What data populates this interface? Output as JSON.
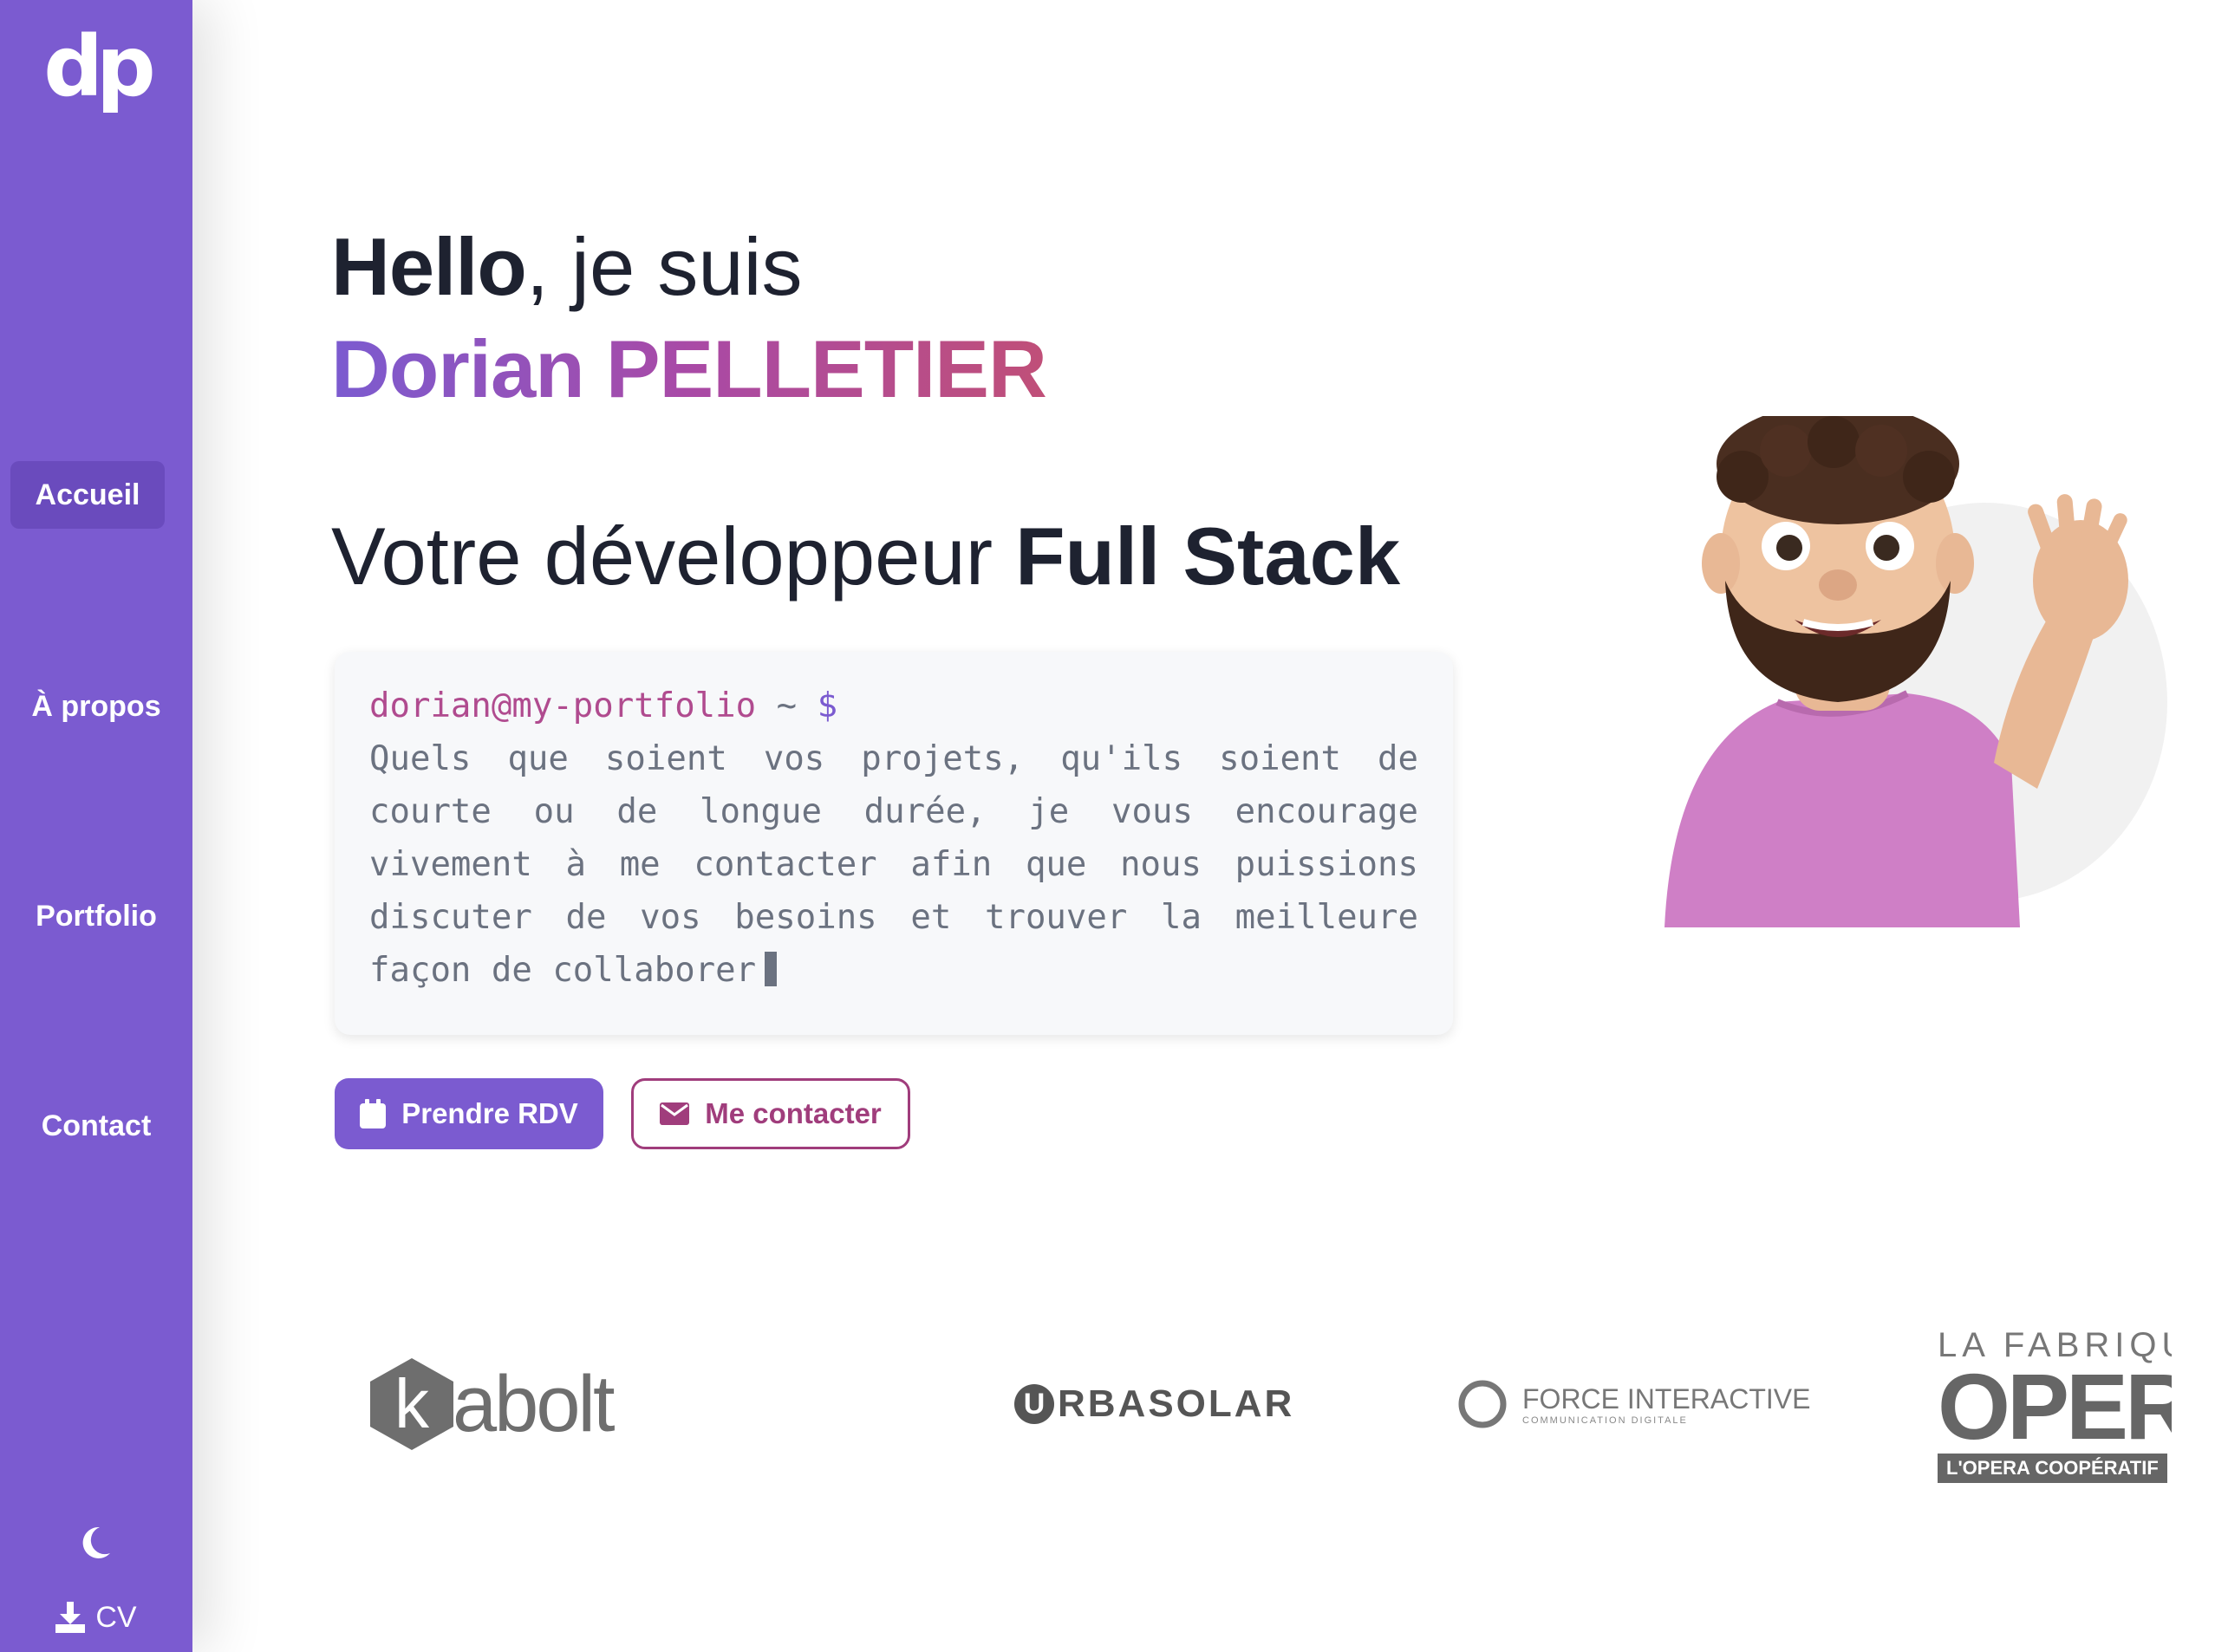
{
  "sidebar": {
    "logo": "dp",
    "nav": [
      {
        "label": "Accueil",
        "active": true
      },
      {
        "label": "À propos",
        "active": false
      },
      {
        "label": "Portfolio",
        "active": false
      },
      {
        "label": "Contact",
        "active": false
      }
    ],
    "theme_icon": "moon-icon",
    "cv_label": "CV",
    "cv_icon": "download-icon"
  },
  "hero": {
    "hello_bold": "Hello",
    "hello_rest": ", je suis",
    "name": "Dorian PELLETIER",
    "subtitle_prefix": "Votre développeur ",
    "subtitle_bold": "Full Stack"
  },
  "terminal": {
    "user": "dorian@my-portfolio",
    "tilde": "~",
    "dollar": "$",
    "text": "Quels que soient vos projets, qu'ils soient de courte ou de longue durée, je vous encourage vivement à me contacter afin que nous puissions discuter de vos besoins et trouver la meilleure façon de collaborer"
  },
  "buttons": {
    "rdv_label": "Prendre RDV",
    "rdv_icon": "calendar-icon",
    "contact_label": "Me contacter",
    "contact_icon": "envelope-icon"
  },
  "clients": [
    {
      "name": "kabolt",
      "text": "abolt",
      "mark": "k"
    },
    {
      "name": "urbasolar",
      "text": "RBASOLAR",
      "mark": "U"
    },
    {
      "name": "force-interactive",
      "text": "FORCE INTERACTIVE",
      "sub": "COMMUNICATION DIGITALE"
    },
    {
      "name": "la-fabrique-opera",
      "top": "LA FABRIQUE",
      "main": "OPERA",
      "band": "L'OPERA COOPÉRATIF"
    }
  ],
  "colors": {
    "sidebar": "#7b5bd0",
    "accent": "#7b5bd0",
    "accent_secondary": "#a03d7c"
  }
}
